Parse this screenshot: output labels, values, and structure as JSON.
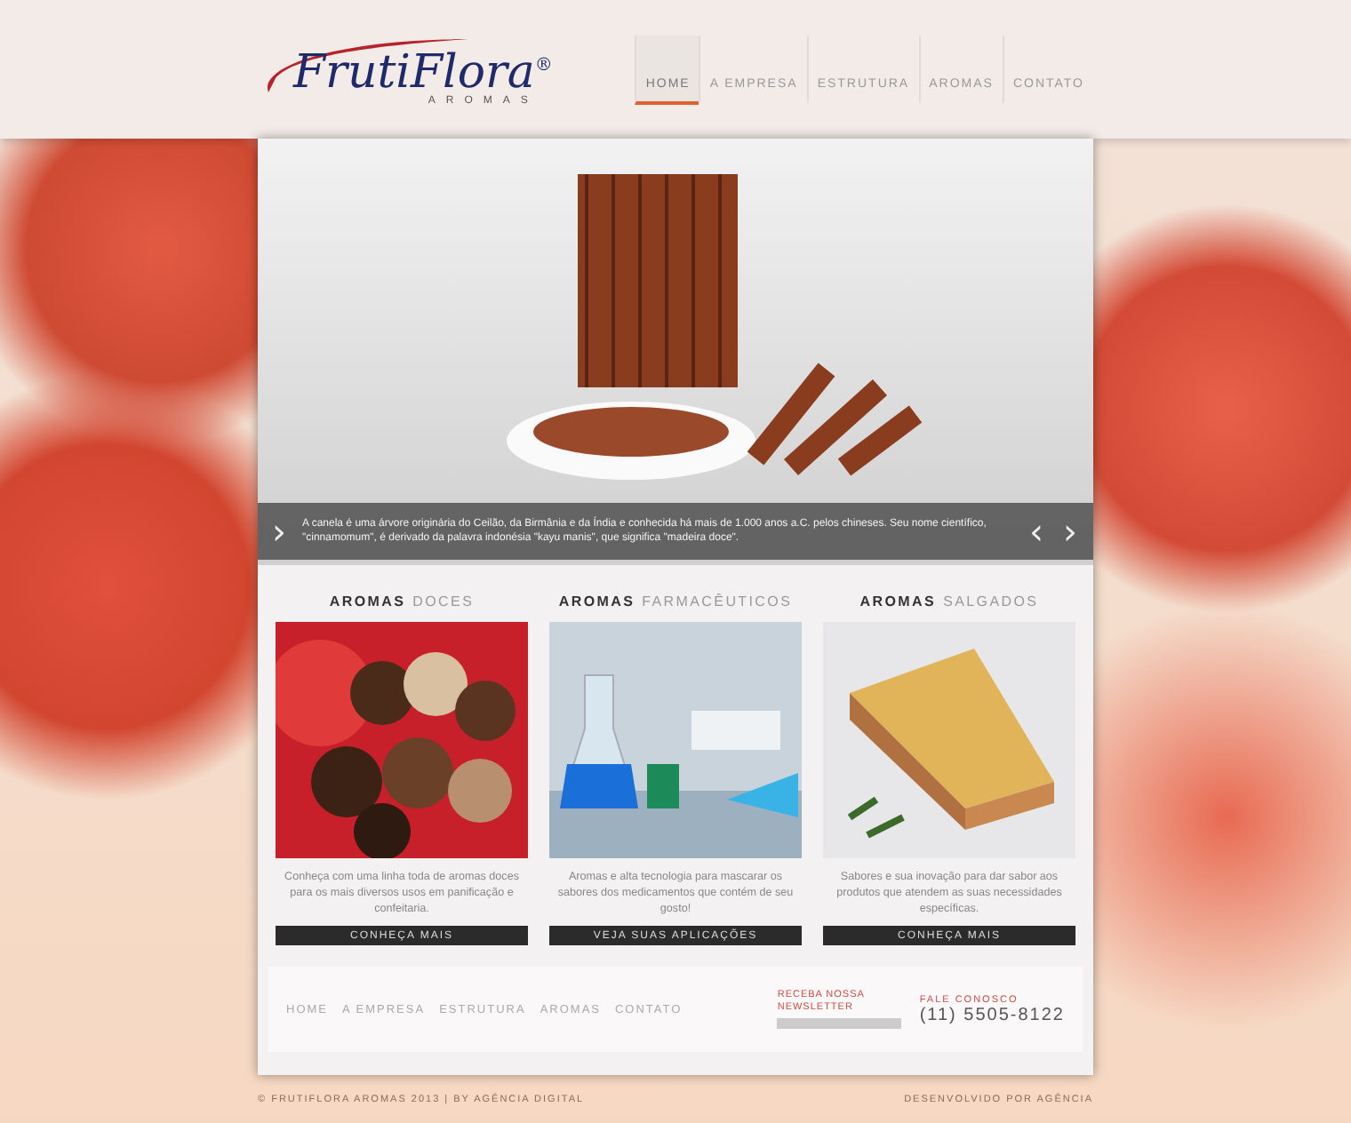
{
  "header": {
    "logo": {
      "name": "FrutiFlora",
      "mark": "®",
      "tagline": "AROMAS"
    },
    "nav": [
      {
        "label": "HOME",
        "selected": true
      },
      {
        "label": "A EMPRESA",
        "selected": false
      },
      {
        "label": "ESTRUTURA",
        "selected": false
      },
      {
        "label": "AROMAS",
        "selected": false
      },
      {
        "label": "CONTATO",
        "selected": false
      }
    ]
  },
  "slider": {
    "caption": "A canela é uma árvore originária do Ceilão, da Birmânia e da Índia e conhecida há mais de 1.000 anos a.C. pelos chineses. Seu nome científico, \"cinnamomum\", é derivado da palavra indonésia \"kayu manis\", que significa \"madeira doce\".",
    "next": "›",
    "prev_arrow": "‹",
    "next_arrow": "›"
  },
  "sections": [
    {
      "kind": "sweets",
      "title": "AROMAS",
      "subtitle": "DOCES",
      "text": "Conheça com uma linha toda de aromas doces para os mais diversos usos em panificação e confeitaria.",
      "button": "CONHEÇA MAIS"
    },
    {
      "kind": "pharma",
      "title": "AROMAS",
      "subtitle": "FARMACÊUTICOS",
      "text": "Aromas e alta tecnologia para mascarar os sabores dos medicamentos que contém de seu gosto!",
      "button": "VEJA SUAS APLICAÇÕES"
    },
    {
      "kind": "savory",
      "title": "AROMAS",
      "subtitle": "SALGADOS",
      "text": "Sabores e sua inovação para dar sabor aos produtos que atendem as suas necessidades específicas.",
      "button": "CONHEÇA MAIS"
    }
  ],
  "footer": {
    "nav": [
      "HOME",
      "A EMPRESA",
      "ESTRUTURA",
      "AROMAS",
      "CONTATO"
    ],
    "newsletter": {
      "title": "RECEBA NOSSA",
      "subtitle": "NEWSLETTER"
    },
    "contact": {
      "label": "FALE CONOSCO",
      "phone": "(11) 5505-8122"
    },
    "copyright": "© FRUTIFLORA AROMAS 2013 | BY AGÊNCIA DIGITAL",
    "credits": "DESENVOLVIDO POR AGÊNCIA"
  }
}
